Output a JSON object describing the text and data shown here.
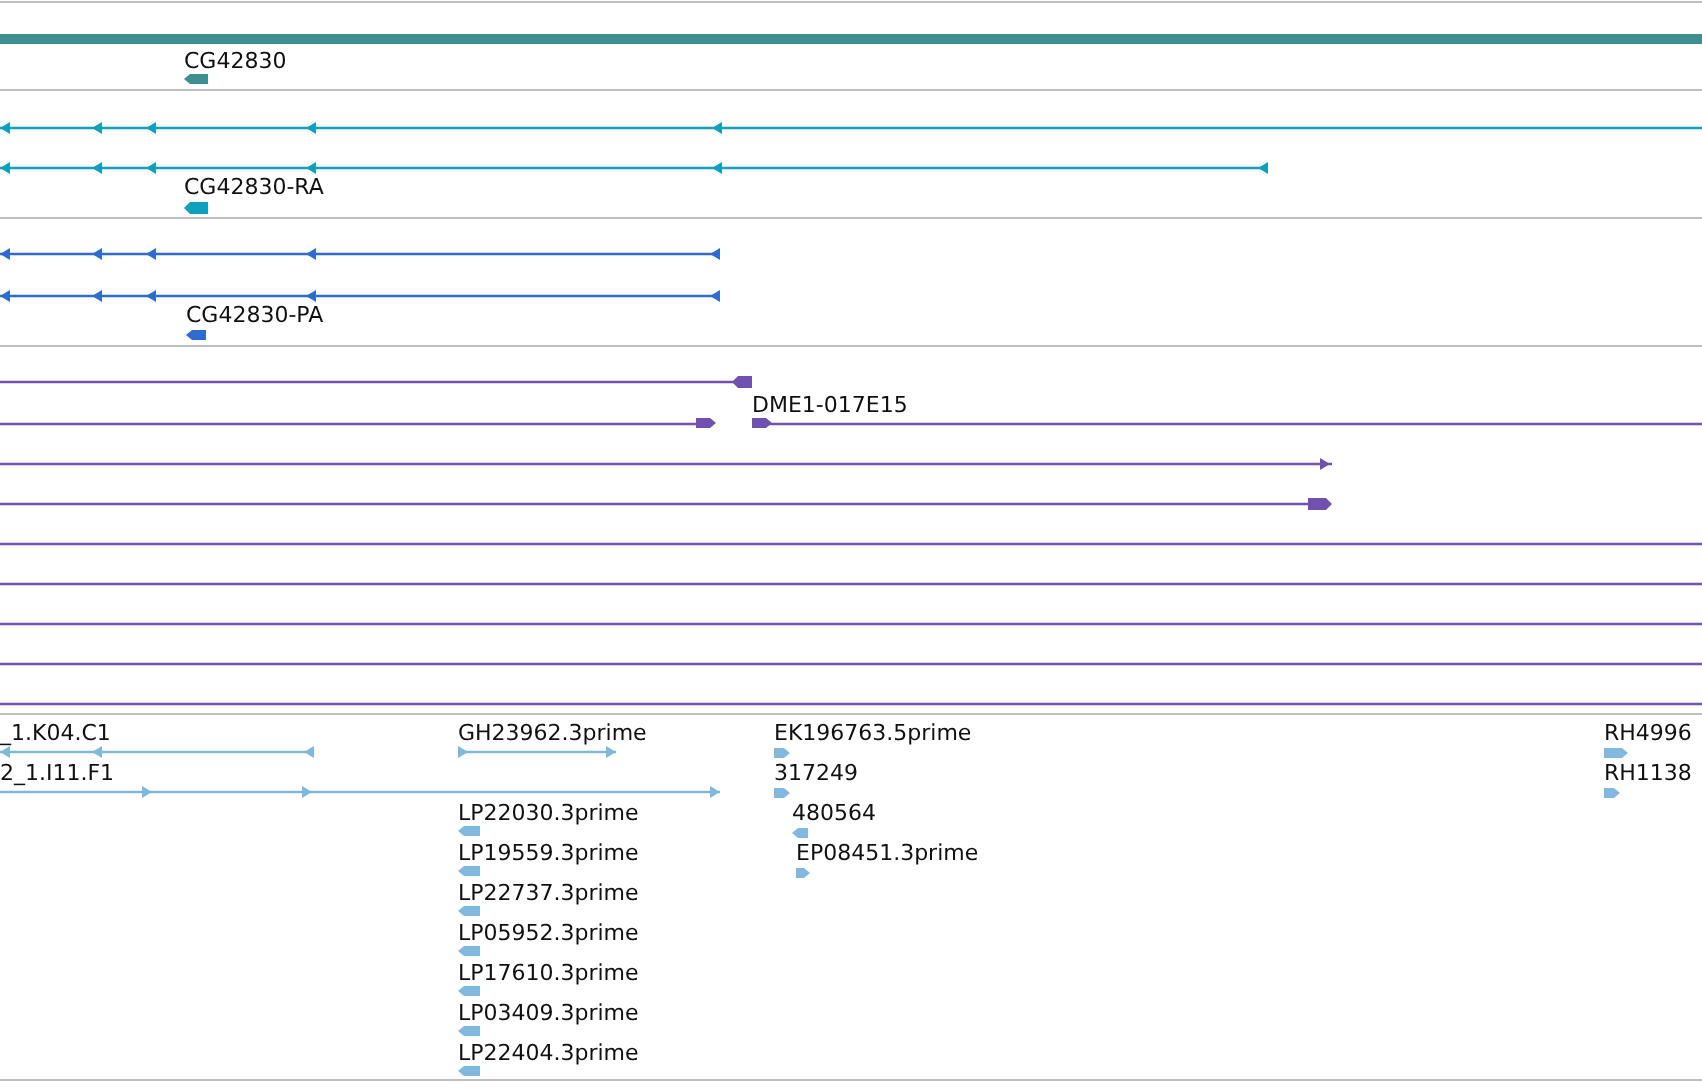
{
  "tracks": [
    {
      "kind": "gene",
      "color": "#3f8f91",
      "features": [
        {
          "label": "CG42830",
          "reverse": true
        }
      ]
    },
    {
      "kind": "transcript",
      "color": "#0fa0c0",
      "features": [
        {
          "label": "CG42830-RA",
          "reverse": true
        }
      ]
    },
    {
      "kind": "protein",
      "color": "#2f6bd0",
      "features": [
        {
          "label": "CG42830-PA",
          "reverse": true
        }
      ]
    },
    {
      "kind": "clone",
      "color": "#7050b0",
      "features": [
        {
          "label": "DME1-017E15",
          "reverse": false
        }
      ]
    },
    {
      "kind": "est",
      "color": "#80b8e0",
      "features": [
        {
          "label": "_1.K04.C1",
          "reverse": true
        },
        {
          "label": "2_1.I11.F1",
          "reverse": false
        },
        {
          "label": "GH23962.3prime",
          "reverse": false
        },
        {
          "label": "EK196763.5prime",
          "reverse": false
        },
        {
          "label": "317249",
          "reverse": false
        },
        {
          "label": "480564",
          "reverse": true
        },
        {
          "label": "EP08451.3prime",
          "reverse": false
        },
        {
          "label": "LP22030.3prime",
          "reverse": true
        },
        {
          "label": "LP19559.3prime",
          "reverse": true
        },
        {
          "label": "LP22737.3prime",
          "reverse": true
        },
        {
          "label": "LP05952.3prime",
          "reverse": true
        },
        {
          "label": "LP17610.3prime",
          "reverse": true
        },
        {
          "label": "LP03409.3prime",
          "reverse": true
        },
        {
          "label": "LP22404.3prime",
          "reverse": true
        },
        {
          "label": "RH4996",
          "reverse": false
        },
        {
          "label": "RH1138",
          "reverse": false
        }
      ]
    }
  ]
}
